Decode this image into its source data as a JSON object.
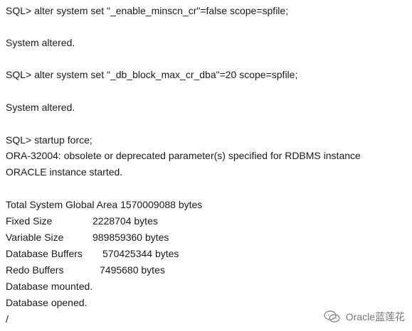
{
  "console": {
    "lines": [
      {
        "text": "SQL> alter system set \"_enable_minscn_cr\"=false scope=spfile;"
      },
      {
        "text": "System altered."
      },
      {
        "text": "SQL> alter system set \"_db_block_max_cr_dba\"=20 scope=spfile;"
      },
      {
        "text": "System altered."
      },
      {
        "text": "SQL> startup force;"
      },
      {
        "text": "ORA-32004: obsolete or deprecated parameter(s) specified for RDBMS instance"
      },
      {
        "text": "ORACLE instance started."
      },
      {
        "text": "Total System Global Area 1570009088 bytes"
      },
      {
        "label": "Fixed Size",
        "value": "2228704 bytes"
      },
      {
        "label": "Variable Size",
        "value": "989859360 bytes"
      },
      {
        "label": "Database Buffers",
        "value": "570425344 bytes"
      },
      {
        "label": "Redo Buffers",
        "value": "7495680 bytes"
      },
      {
        "text": "Database mounted."
      },
      {
        "text": "Database opened."
      },
      {
        "text": "/"
      }
    ]
  },
  "watermark": {
    "text": "Oracle蓝莲花",
    "icon": "wechat-icon"
  }
}
